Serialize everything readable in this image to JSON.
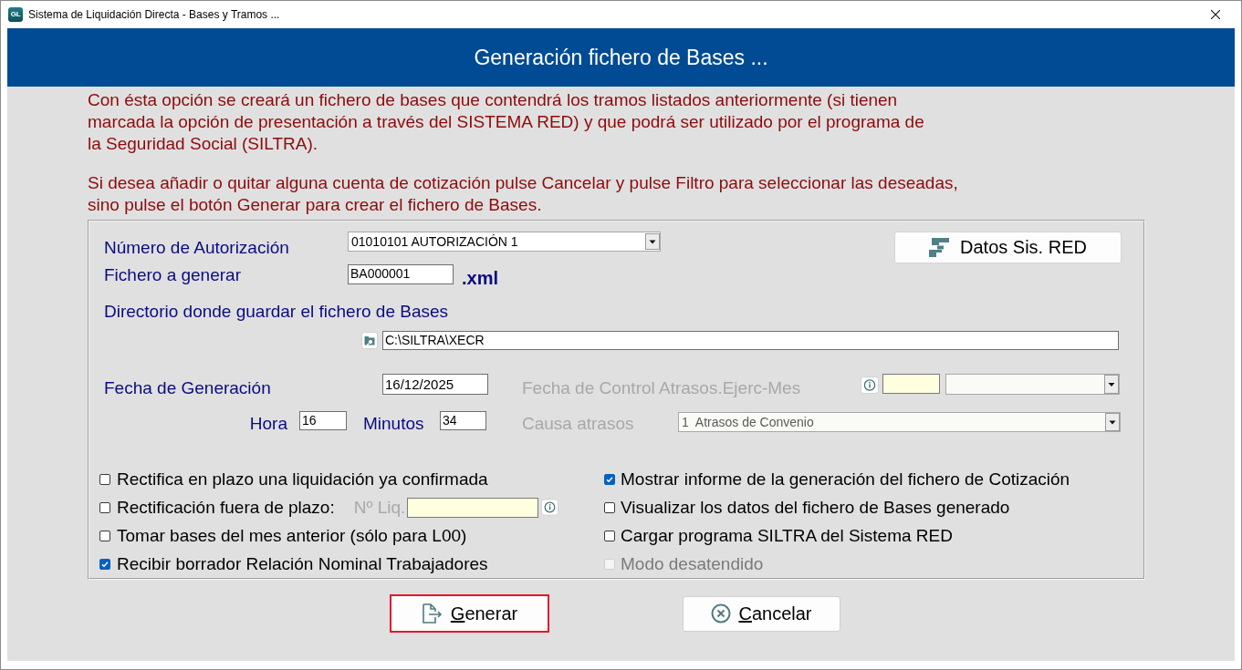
{
  "window": {
    "logo": "GL",
    "title": "Sistema de Liquidación Directa - Bases y Tramos ..."
  },
  "header": {
    "title": "Generación fichero de Bases ..."
  },
  "intro": [
    [
      "Con ésta opción se creará un fichero de bases que contendrá los tramos listados anteriormente (si tienen",
      "marcada la opción de presentación a través del SISTEMA RED) y que podrá ser utilizado por el programa de",
      "la Seguridad Social (SILTRA)."
    ],
    [
      "Si desea añadir o quitar alguna cuenta de cotización pulse Cancelar y pulse Filtro para seleccionar las deseadas,",
      "sino pulse el botón Generar para crear el fichero de Bases."
    ]
  ],
  "form": {
    "autorizacion": {
      "label": "Número de Autorización",
      "value": "01010101 AUTORIZACIÓN 1"
    },
    "datos_button": {
      "label": "Datos Sis. RED"
    },
    "fichero": {
      "label": "Fichero a generar",
      "value": "BA000001",
      "extension": ".xml"
    },
    "directorio": {
      "label": "Directorio donde guardar el fichero de Bases",
      "value": "C:\\SILTRA\\XECR"
    },
    "fecha_generacion": {
      "label": "Fecha de Generación",
      "value": "16/12/2025"
    },
    "hora": {
      "label": "Hora",
      "value": "16"
    },
    "minutos": {
      "label": "Minutos",
      "value": "34"
    },
    "fecha_control": {
      "label": "Fecha de Control Atrasos.Ejerc-Mes",
      "disabled": true
    },
    "causa_atrasos": {
      "label": "Causa atrasos",
      "value": "1  Atrasos de Convenio",
      "disabled": true
    }
  },
  "options_left": [
    {
      "kind": "check",
      "label": "Rectifica en plazo una liquidación ya confirmada",
      "checked": false,
      "disabled": false
    },
    {
      "kind": "check_with_field",
      "label": "Rectificación fuera de plazo:",
      "checked": false,
      "disabled": false,
      "field": {
        "label": "Nº Liq.",
        "disabled": true
      }
    },
    {
      "kind": "check",
      "label": "Tomar bases del mes anterior (sólo para L00)",
      "checked": false,
      "disabled": false
    },
    {
      "kind": "check",
      "label": "Recibir borrador Relación Nominal Trabajadores",
      "checked": true,
      "disabled": false
    }
  ],
  "options_right": [
    {
      "label": "Mostrar informe de la generación del fichero de Cotización",
      "checked": true,
      "disabled": false
    },
    {
      "label": "Visualizar los datos del fichero de Bases generado",
      "checked": false,
      "disabled": false
    },
    {
      "label": "Cargar programa SILTRA del Sistema RED",
      "checked": false,
      "disabled": false
    },
    {
      "label": "Modo desatendido",
      "checked": false,
      "disabled": true
    }
  ],
  "buttons": [
    {
      "kind": "generate",
      "label": "Generar",
      "focused": true
    },
    {
      "kind": "cancel",
      "label": "Cancelar",
      "focused": false
    }
  ]
}
